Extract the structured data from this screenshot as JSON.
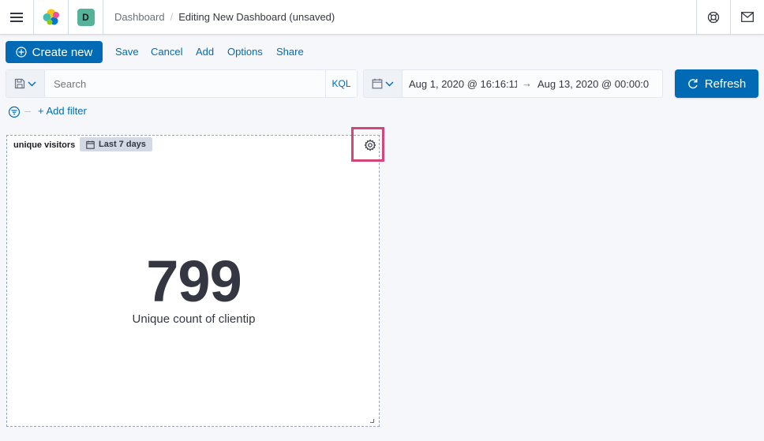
{
  "header": {
    "space_initial": "D",
    "breadcrumbs": [
      "Dashboard",
      "Editing New Dashboard (unsaved)"
    ],
    "breadcrumb_separator": "/"
  },
  "toolbar": {
    "create_label": "Create new",
    "links": [
      "Save",
      "Cancel",
      "Add",
      "Options",
      "Share"
    ]
  },
  "query": {
    "placeholder": "Search",
    "language": "KQL",
    "date_start": "Aug 1, 2020 @ 16:16:11.",
    "date_arrow": "→",
    "date_end": "Aug 13, 2020 @ 00:00:0",
    "refresh_label": "Refresh"
  },
  "filters": {
    "add_filter_label": "+ Add filter"
  },
  "panel": {
    "title": "unique visitors",
    "time_badge": "Last 7 days",
    "metric_value": "799",
    "metric_label": "Unique count of clientip"
  },
  "colors": {
    "primary": "#006bb4",
    "space_badge": "#54b399",
    "highlight": "#d6457a",
    "text": "#343741"
  },
  "icons": [
    "menu-icon",
    "elastic-logo",
    "help-icon",
    "mail-icon",
    "plus-circle-icon",
    "save-icon",
    "calendar-icon",
    "chevron-down-icon",
    "refresh-icon",
    "filter-icon",
    "gear-icon"
  ]
}
